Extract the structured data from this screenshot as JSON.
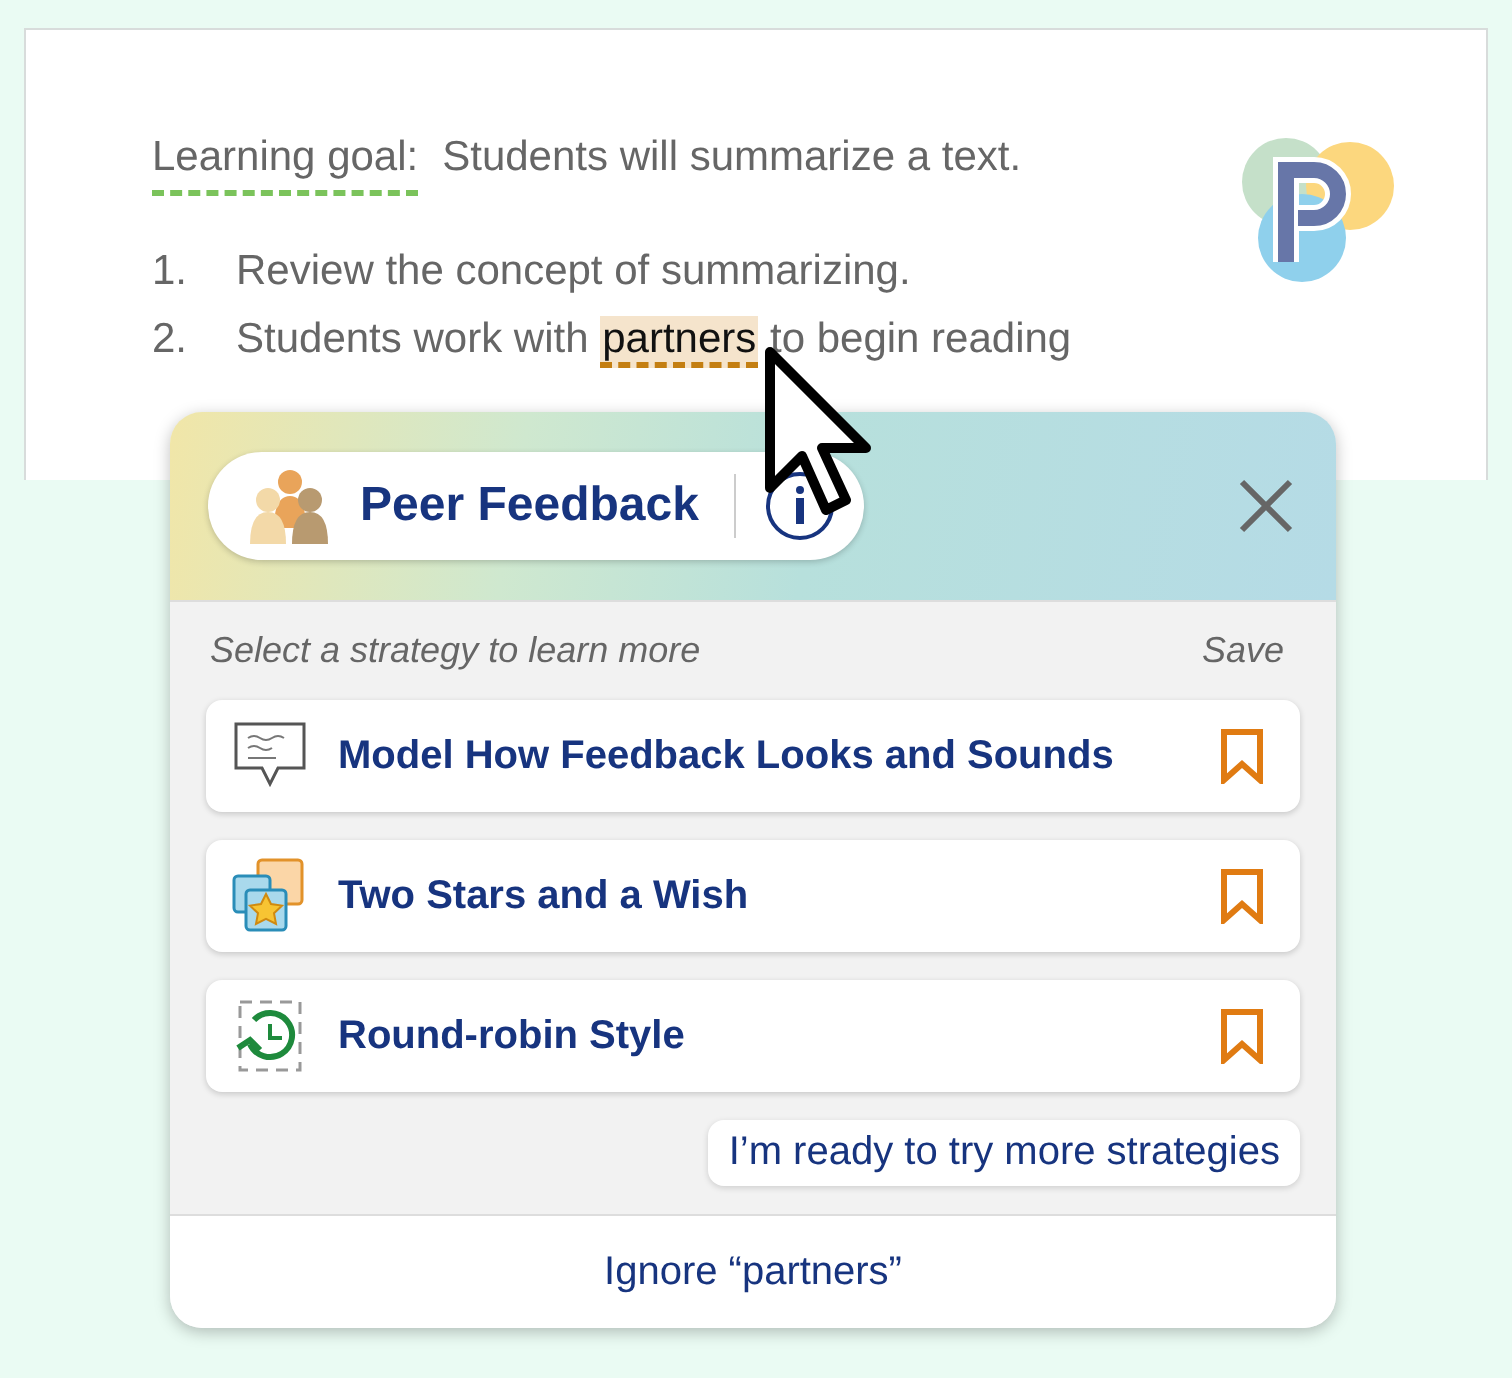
{
  "document": {
    "goal_label": "Learning goal:",
    "goal_text": "Students will summarize a text.",
    "steps": [
      {
        "number": "1.",
        "before": "Review the concept of summarizing."
      },
      {
        "number": "2.",
        "before": "Students work with",
        "highlight": "partners",
        "after": "to begin reading"
      }
    ]
  },
  "popup": {
    "category": "Peer Feedback",
    "hint": "Select a strategy to learn more",
    "save_label": "Save",
    "strategies": [
      {
        "kind": "speech",
        "title": "Model How Feedback Looks and Sounds",
        "saved": false
      },
      {
        "kind": "stars",
        "title": "Two Stars and a Wish",
        "saved": false
      },
      {
        "kind": "cycle",
        "title": "Round-robin Style",
        "saved": false
      }
    ],
    "more_button": "I’m ready to try more strategies",
    "ignore_button": "Ignore “partners”"
  }
}
